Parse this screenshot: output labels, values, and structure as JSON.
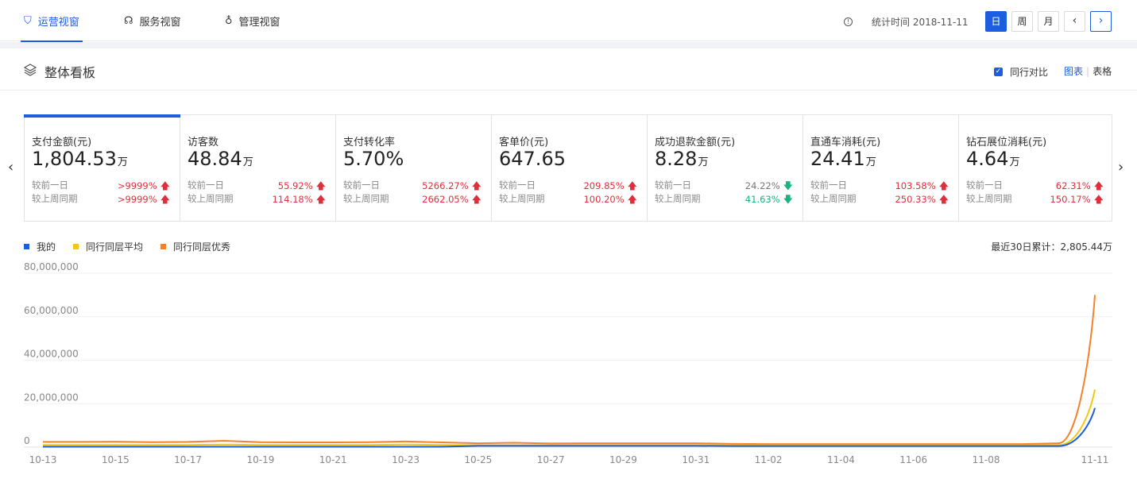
{
  "nav": {
    "tabs": [
      {
        "label": "运营视窗",
        "icon": "shield-icon"
      },
      {
        "label": "服务视窗",
        "icon": "headset-icon"
      },
      {
        "label": "管理视窗",
        "icon": "medal-icon"
      }
    ],
    "stat_time_label": "统计时间 2018-11-11",
    "periods": [
      "日",
      "周",
      "月"
    ],
    "prev_symbol": "‹",
    "next_symbol": "›"
  },
  "section": {
    "title": "整体看板",
    "compare_label": "同行对比",
    "compare_checked": true,
    "view_chart": "图表",
    "view_table": "表格"
  },
  "cards": [
    {
      "label": "支付金额(元)",
      "value": "1,804.53",
      "unit": "万",
      "day_label": "较前一日",
      "day_pct": ">9999%",
      "day_dir": "up",
      "week_label": "较上周同期",
      "week_pct": ">9999%",
      "week_dir": "up"
    },
    {
      "label": "访客数",
      "value": "48.84",
      "unit": "万",
      "day_label": "较前一日",
      "day_pct": "55.92%",
      "day_dir": "up",
      "week_label": "较上周同期",
      "week_pct": "114.18%",
      "week_dir": "up"
    },
    {
      "label": "支付转化率",
      "value": "5.70%",
      "unit": "",
      "day_label": "较前一日",
      "day_pct": "5266.27%",
      "day_dir": "up",
      "week_label": "较上周同期",
      "week_pct": "2662.05%",
      "week_dir": "up"
    },
    {
      "label": "客单价(元)",
      "value": "647.65",
      "unit": "",
      "day_label": "较前一日",
      "day_pct": "209.85%",
      "day_dir": "up",
      "week_label": "较上周同期",
      "week_pct": "100.20%",
      "week_dir": "up"
    },
    {
      "label": "成功退款金额(元)",
      "value": "8.28",
      "unit": "万",
      "day_label": "较前一日",
      "day_pct": "24.22%",
      "day_dir": "down",
      "week_label": "较上周同期",
      "week_pct": "41.63%",
      "week_dir": "down"
    },
    {
      "label": "直通车消耗(元)",
      "value": "24.41",
      "unit": "万",
      "day_label": "较前一日",
      "day_pct": "103.58%",
      "day_dir": "up",
      "week_label": "较上周同期",
      "week_pct": "250.33%",
      "week_dir": "up"
    },
    {
      "label": "钻石展位消耗(元)",
      "value": "4.64",
      "unit": "万",
      "day_label": "较前一日",
      "day_pct": "62.31%",
      "day_dir": "up",
      "week_label": "较上周同期",
      "week_pct": "150.17%",
      "week_dir": "up"
    }
  ],
  "cumulative": "最近30日累计：2,805.44万",
  "colors": {
    "accent": "#1d5de0",
    "up": "#e02f3c",
    "down": "#19b37d",
    "series_mine": "#1d5de0",
    "series_avg": "#f2c811",
    "series_top": "#f5822a"
  },
  "chart_data": {
    "type": "line",
    "x": [
      "10-13",
      "10-14",
      "10-15",
      "10-16",
      "10-17",
      "10-18",
      "10-19",
      "10-20",
      "10-21",
      "10-22",
      "10-23",
      "10-24",
      "10-25",
      "10-26",
      "10-27",
      "10-28",
      "10-29",
      "10-30",
      "10-31",
      "11-01",
      "11-02",
      "11-03",
      "11-04",
      "11-05",
      "11-06",
      "11-07",
      "11-08",
      "11-09",
      "11-10",
      "11-11"
    ],
    "xticks": [
      "10-13",
      "10-15",
      "10-17",
      "10-19",
      "10-21",
      "10-23",
      "10-25",
      "10-27",
      "10-29",
      "10-31",
      "11-02",
      "11-04",
      "11-06",
      "11-08",
      "11-11"
    ],
    "yticks": [
      "0",
      "20,000,000",
      "40,000,000",
      "60,000,000",
      "80,000,000"
    ],
    "ylim": [
      0,
      80000000
    ],
    "series": [
      {
        "name": "我的",
        "values": [
          200000,
          200000,
          200000,
          200000,
          200000,
          200000,
          200000,
          200000,
          200000,
          200000,
          200000,
          200000,
          600000,
          600000,
          600000,
          600000,
          600000,
          600000,
          600000,
          500000,
          500000,
          500000,
          500000,
          500000,
          500000,
          500000,
          500000,
          500000,
          500000,
          18000000
        ]
      },
      {
        "name": "同行同层平均",
        "values": [
          1000000,
          1000000,
          1000000,
          1000000,
          1000000,
          1200000,
          1000000,
          1000000,
          1000000,
          1000000,
          1200000,
          1000000,
          900000,
          900000,
          900000,
          900000,
          900000,
          900000,
          900000,
          800000,
          800000,
          800000,
          800000,
          800000,
          800000,
          800000,
          800000,
          800000,
          900000,
          26500000
        ]
      },
      {
        "name": "同行同层优秀",
        "values": [
          2400000,
          2400000,
          2500000,
          2300000,
          2400000,
          2900000,
          2300000,
          2200000,
          2200000,
          2300000,
          2600000,
          2200000,
          1800000,
          2000000,
          1700000,
          1800000,
          1800000,
          1800000,
          1800000,
          1500000,
          1400000,
          1400000,
          1400000,
          1400000,
          1400000,
          1400000,
          1400000,
          1400000,
          1800000,
          70000000
        ]
      }
    ]
  }
}
